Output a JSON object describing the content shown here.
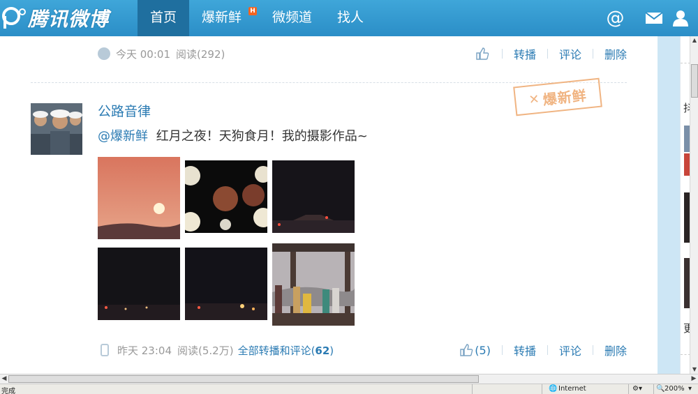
{
  "brand": {
    "logo_text": "腾讯微博"
  },
  "nav": {
    "items": [
      {
        "label": "首页",
        "active": true
      },
      {
        "label": "爆新鲜",
        "badge": "H"
      },
      {
        "label": "微频道"
      },
      {
        "label": "找人"
      }
    ]
  },
  "top_icons": {
    "at": "@",
    "mail": "✉",
    "user": "👤"
  },
  "prev_post": {
    "time": "今天 00:01",
    "read": "阅读(292)",
    "actions": {
      "repost": "转播",
      "comment": "评论",
      "delete": "删除"
    }
  },
  "post": {
    "author": "公路音律",
    "stamp": "爆新鲜",
    "mention": "@爆新鲜",
    "text": "红月之夜！天狗食月！我的摄影作品~",
    "time": "昨天 23:04",
    "read": "阅读(5.2万)",
    "all_label": "全部转播和评论(",
    "all_count": "62",
    "all_close": ")",
    "likes": "(5)",
    "actions": {
      "repost": "转播",
      "comment": "评论",
      "delete": "删除"
    }
  },
  "side": {
    "char1": "抖",
    "char2": "更"
  },
  "status": {
    "left": "完成",
    "zone": "Internet",
    "zoom": "200%"
  }
}
